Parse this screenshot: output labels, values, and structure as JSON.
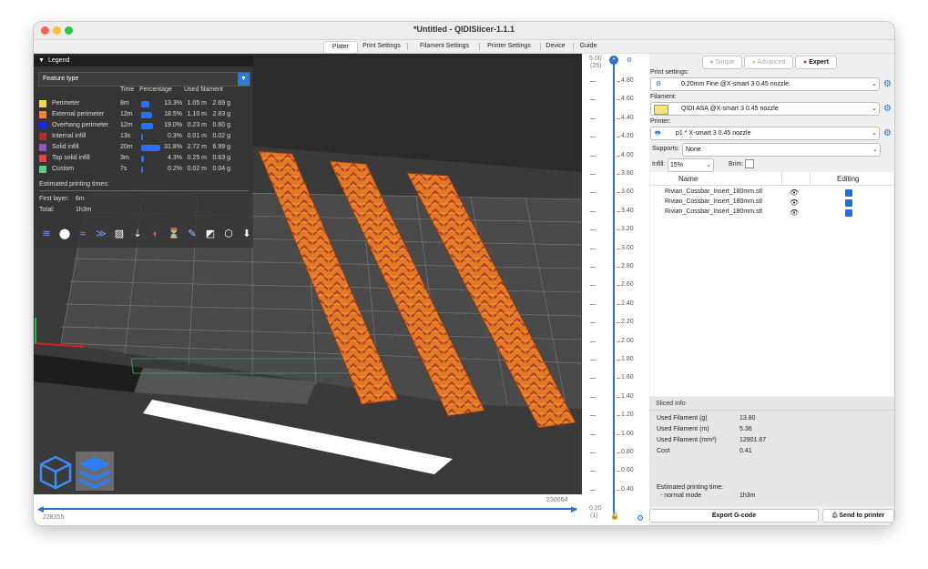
{
  "window": {
    "title": "*Untitled - QIDISlicer-1.1.1"
  },
  "tabs": [
    "Plater",
    "Print Settings",
    "Filament Settings",
    "Printer Settings",
    "Device",
    "Guide"
  ],
  "legend": {
    "title": "Legend",
    "view_type": "Feature type",
    "columns": {
      "time": "Time",
      "percentage": "Percentage",
      "used_filament": "Used filament"
    },
    "items": [
      {
        "name": "Perimeter",
        "time": "8m",
        "percent": "13.3%",
        "length": "1.05 m",
        "weight": "2.69 g",
        "color": "#f7d94c",
        "fraction": 0.133
      },
      {
        "name": "External perimeter",
        "time": "12m",
        "percent": "18.5%",
        "length": "1.10 m",
        "weight": "2.83 g",
        "color": "#ff7d38",
        "fraction": 0.185
      },
      {
        "name": "Overhang perimeter",
        "time": "12m",
        "percent": "19.0%",
        "length": "0.23 m",
        "weight": "0.60 g",
        "color": "#1f1fff",
        "fraction": 0.19
      },
      {
        "name": "Internal infill",
        "time": "13s",
        "percent": "0.3%",
        "length": "0.01 m",
        "weight": "0.02 g",
        "color": "#b03029",
        "fraction": 0.003
      },
      {
        "name": "Solid infill",
        "time": "20m",
        "percent": "31.8%",
        "length": "2.72 m",
        "weight": "6.99 g",
        "color": "#9654cc",
        "fraction": 0.318
      },
      {
        "name": "Top solid infill",
        "time": "3m",
        "percent": "4.3%",
        "length": "0.25 m",
        "weight": "0.63 g",
        "color": "#f04040",
        "fraction": 0.043
      },
      {
        "name": "Custom",
        "time": "7s",
        "percent": "0.2%",
        "length": "0.02 m",
        "weight": "0.04 g",
        "color": "#5ec98b",
        "fraction": 0.002
      }
    ],
    "est_title": "Estimated printing times:",
    "first_layer_label": "First layer:",
    "first_layer_value": "6m",
    "total_label": "Total:",
    "total_value": "1h3m"
  },
  "viewport": {
    "h_slider_right": "230064",
    "h_slider_left": "228355"
  },
  "vertical_slider": {
    "top_value": "5.00",
    "top_layer": "(25)",
    "bottom_value": "0.20",
    "bottom_layer": "(1)",
    "ticks": [
      "4.80",
      "4.60",
      "4.40",
      "4.20",
      "4.00",
      "3.80",
      "3.60",
      "3.40",
      "3.20",
      "3.00",
      "2.80",
      "2.60",
      "2.40",
      "2.20",
      "2.00",
      "1.80",
      "1.60",
      "1.40",
      "1.20",
      "1.00",
      "0.80",
      "0.60",
      "0.40"
    ]
  },
  "modes": {
    "simple": "Simple",
    "advanced": "Advanced",
    "expert": "Expert"
  },
  "print_settings": {
    "label": "Print settings:",
    "value": "0.20mm Fine @X-smart 3 0.45 nozzle"
  },
  "filament": {
    "label": "Filament:",
    "value": "QIDI ASA @X-smart 3 0.45 nozzle",
    "color": "#f4e27a"
  },
  "printer": {
    "label": "Printer:",
    "value": "p1 * X-smart 3 0.45 nozzle"
  },
  "supports": {
    "label": "Supports:",
    "value": "None"
  },
  "infill": {
    "label": "Infill:",
    "value": "15%"
  },
  "brim": {
    "label": "Brim:"
  },
  "object_list": {
    "col_name": "Name",
    "col_editing": "Editing",
    "objects": [
      "Rivian_Cossbar_Insert_180mm.stl",
      "Rivian_Cossbar_Insert_180mm.stl",
      "Rivian_Cossbar_Insert_180mm.stl"
    ]
  },
  "sliced_info": {
    "title": "Sliced Info",
    "rows": [
      {
        "label": "Used Filament (g)",
        "value": "13.80"
      },
      {
        "label": "Used Filament (m)",
        "value": "5.36"
      },
      {
        "label": "Used Filament (mm³)",
        "value": "12901.67"
      },
      {
        "label": "Cost",
        "value": "0.41"
      }
    ],
    "est_label": "Estimated printing time:",
    "mode_label": "- normal mode",
    "mode_value": "1h3m"
  },
  "buttons": {
    "export": "Export G-code",
    "send": "Send to printer"
  },
  "colors": {
    "accent": "#2b6fd6",
    "part": "#e07a24"
  }
}
